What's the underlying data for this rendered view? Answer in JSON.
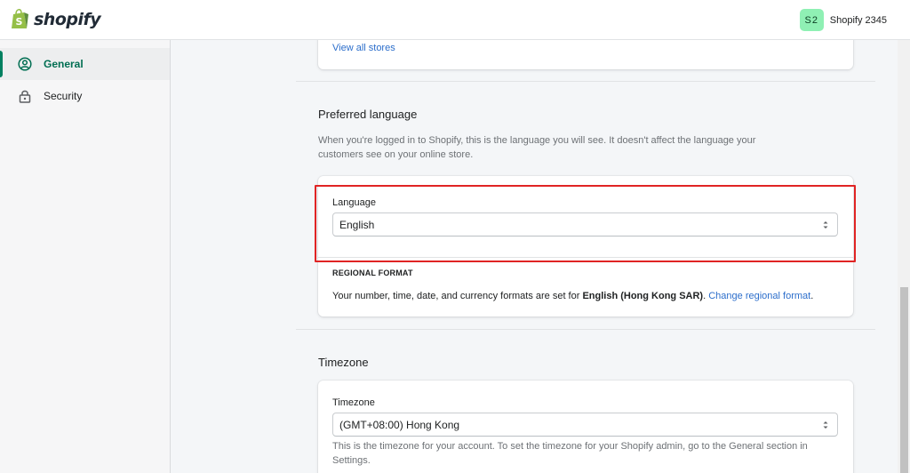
{
  "brand": {
    "name": "shopify",
    "color": "#95bf47"
  },
  "user": {
    "initials": "S2",
    "name": "Shopify 2345",
    "avatar_color": "#8ff0b4"
  },
  "sidebar": {
    "items": [
      {
        "label": "General",
        "icon": "profile-icon",
        "active": true
      },
      {
        "label": "Security",
        "icon": "lock-icon",
        "active": false
      }
    ]
  },
  "stores": {
    "view_all_label": "View all stores"
  },
  "language": {
    "title": "Preferred language",
    "description": "When you're logged in to Shopify, this is the language you will see. It doesn't affect the language your customers see on your online store.",
    "field_label": "Language",
    "value": "English"
  },
  "regional": {
    "heading": "REGIONAL FORMAT",
    "text_prefix": "Your number, time, date, and currency formats are set for ",
    "region": "English (Hong Kong SAR)",
    "text_suffix": ". ",
    "change_link": "Change regional format",
    "end": "."
  },
  "timezone": {
    "title": "Timezone",
    "field_label": "Timezone",
    "value": "(GMT+08:00) Hong Kong",
    "help": "This is the timezone for your account. To set the timezone for your Shopify admin, go to the General section in Settings."
  },
  "colors": {
    "accent": "#008060",
    "link": "#2c6ecb",
    "highlight": "#e02424"
  }
}
